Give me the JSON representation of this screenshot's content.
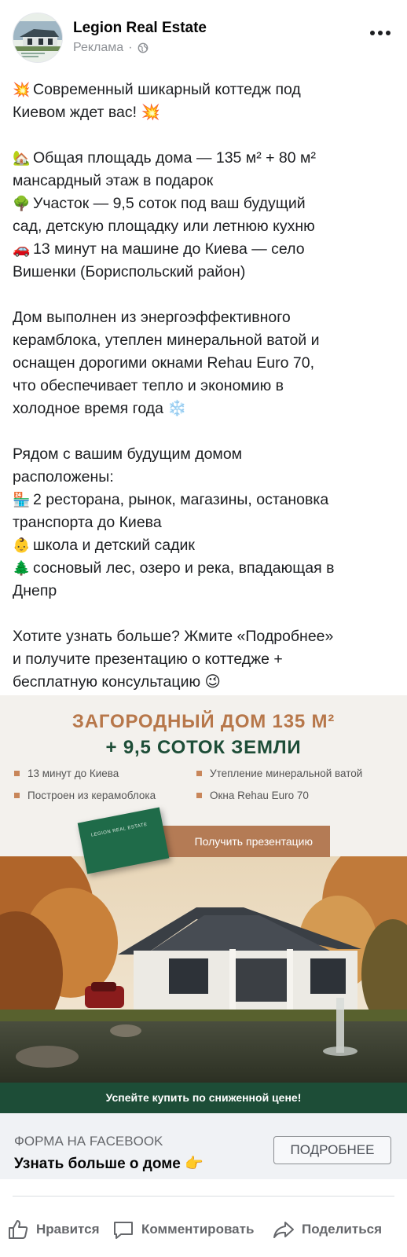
{
  "header": {
    "author": "Legion Real Estate",
    "sponsored": "Реклама",
    "dot": "·",
    "icons": [
      "globe-icon",
      "more-options-icon"
    ]
  },
  "post": {
    "lines": [
      {
        "emoji": "💥",
        "text": "Современный шикарный коттедж под"
      },
      {
        "emoji": "",
        "text": "Киевом ждет вас! 💥"
      },
      {
        "gap": true
      },
      {
        "emoji": "🏡",
        "text": "Общая площадь дома — 135 м² + 80 м²"
      },
      {
        "emoji": "",
        "text": "мансардный этаж в подарок"
      },
      {
        "emoji": "🌳",
        "text": "Участок — 9,5 соток под ваш будущий"
      },
      {
        "emoji": "",
        "text": "сад, детскую площадку или летнюю кухню"
      },
      {
        "emoji": "🚗",
        "text": "13 минут на машине до Киева — село"
      },
      {
        "emoji": "",
        "text": "Вишенки (Бориспольский район)"
      },
      {
        "gap": true
      },
      {
        "emoji": "",
        "text": "Дом выполнен из энергоэффективного"
      },
      {
        "emoji": "",
        "text": "керамблока, утеплен минеральной ватой и"
      },
      {
        "emoji": "",
        "text": "оснащен дорогими окнами Rehau Euro 70,"
      },
      {
        "emoji": "",
        "text": "что обеспечивает тепло и экономию в"
      },
      {
        "emoji": "",
        "text": "холодное время года ❄️"
      },
      {
        "gap": true
      },
      {
        "emoji": "",
        "text": "Рядом с вашим будущим домом"
      },
      {
        "emoji": "",
        "text": "расположены:"
      },
      {
        "emoji": "🏪",
        "text": "2 ресторана, рынок, магазины, остановка"
      },
      {
        "emoji": "",
        "text": "транспорта до Киева"
      },
      {
        "emoji": "👶",
        "text": "школа и детский садик"
      },
      {
        "emoji": "🌲",
        "text": "сосновый лес, озеро и река, впадающая в"
      },
      {
        "emoji": "",
        "text": "Днепр"
      },
      {
        "gap": true
      },
      {
        "emoji": "",
        "text": "Хотите узнать больше? Жмите «Подробнее»"
      },
      {
        "emoji": "",
        "text": "и получите презентацию о коттедже +"
      },
      {
        "emoji": "",
        "text": "бесплатную консультацию 😉"
      }
    ]
  },
  "creative": {
    "title_line1": "ЗАГОРОДНЫЙ ДОМ 135 М²",
    "title_line2": "+ 9,5 СОТОК ЗЕМЛИ",
    "features": [
      "13 минут до Киева",
      "Утепление минеральной ватой",
      "Построен из керамоблока",
      "Окна Rehau Euro 70"
    ],
    "booklet_text": "LEGION REAL ESTATE",
    "cta": "Получить презентацию",
    "bottom_banner": "Успейте купить по сниженной цене!",
    "colors": {
      "accent": "#b7774a",
      "brand_green": "#1d4d37"
    }
  },
  "link": {
    "label": "Форма на Facebook",
    "title": "Узнать больше о доме 👉",
    "button": "ПОДРОБНЕЕ"
  },
  "actions": {
    "like": "Нравится",
    "comment": "Комментировать",
    "share": "Поделиться",
    "icons": [
      "thumbs-up-icon",
      "comment-icon",
      "share-icon"
    ]
  }
}
